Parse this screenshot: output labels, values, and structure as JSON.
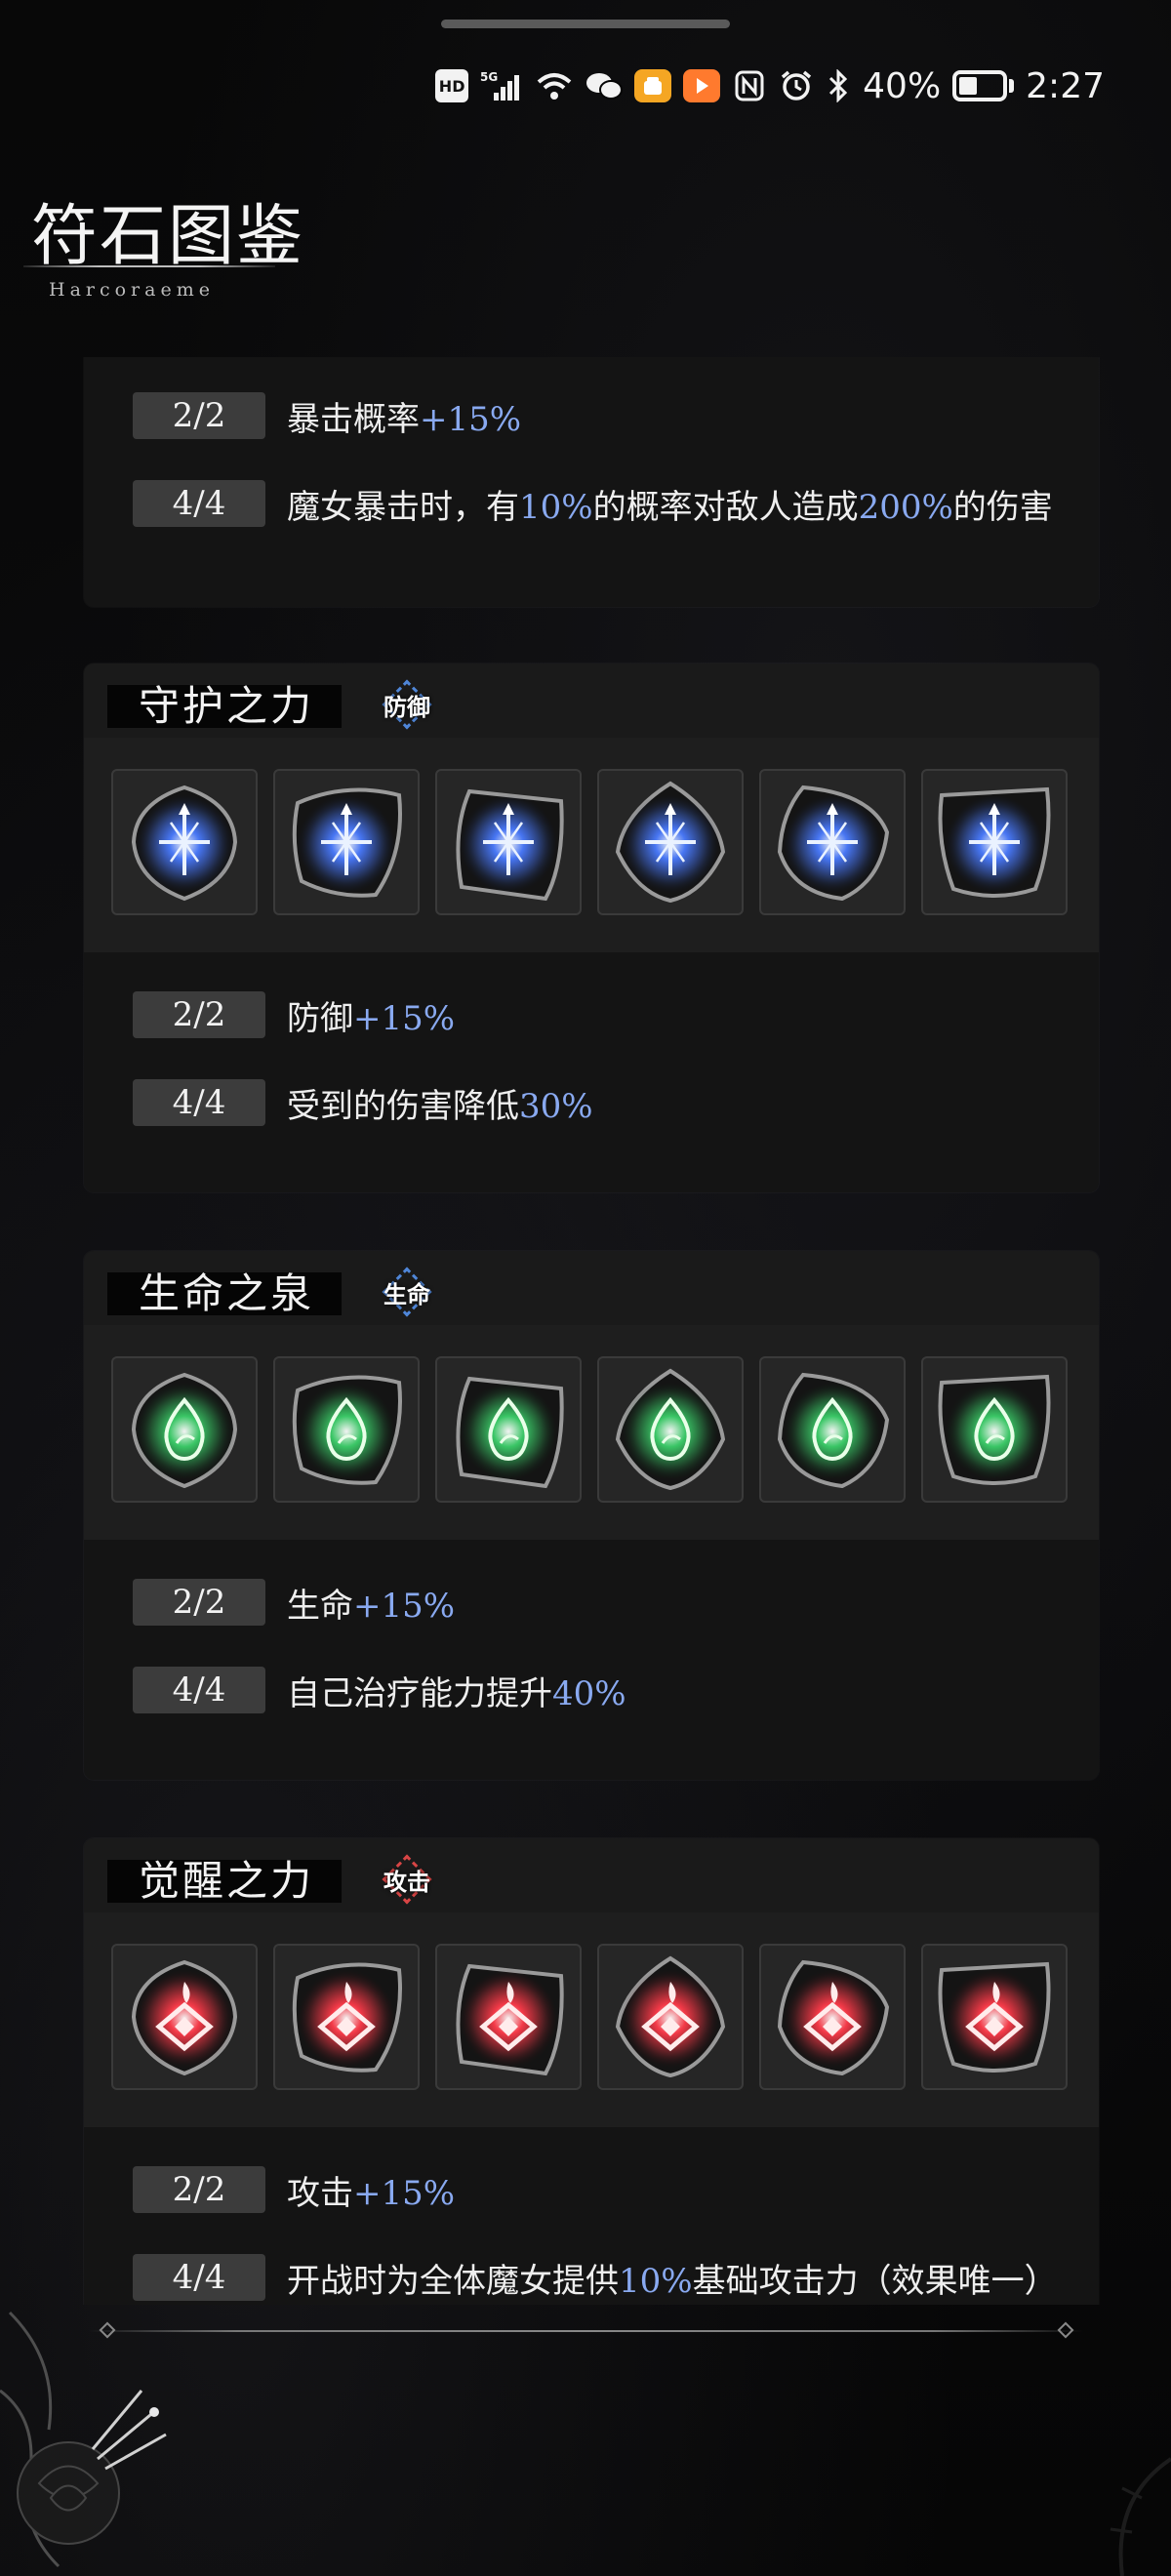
{
  "status_bar": {
    "hd": "HD",
    "network": "5G",
    "battery_text": "40%",
    "battery_level": 0.4,
    "time": "2:27",
    "icons": [
      "hd-icon",
      "signal-5g-icon",
      "wifi-icon",
      "wechat-icon",
      "app-notification-icon",
      "app-notification-icon",
      "nfc-icon",
      "alarm-icon",
      "bluetooth-icon",
      "battery-icon"
    ]
  },
  "header": {
    "title": "符石图鉴",
    "subtitle": "Harcoraeme"
  },
  "cards": [
    {
      "partial": true,
      "stats": [
        {
          "badge": "2/2",
          "parts": [
            {
              "t": "暴击概率"
            },
            {
              "t": "+15%",
              "hl": true
            }
          ]
        },
        {
          "badge": "4/4",
          "parts": [
            {
              "t": "魔女暴击时，有"
            },
            {
              "t": "10%",
              "hl": true
            },
            {
              "t": "的概率对敌人造成"
            },
            {
              "t": "200%",
              "hl": true
            },
            {
              "t": "的伤害"
            }
          ]
        }
      ]
    },
    {
      "title": "守护之力",
      "type": "防御",
      "type_kind": "def",
      "rune_icon": "blue-shield-cross-rune-icon",
      "rune_color": "#4a7bff",
      "rune_count": 6,
      "stats": [
        {
          "badge": "2/2",
          "parts": [
            {
              "t": "防御"
            },
            {
              "t": "+15%",
              "hl": true
            }
          ]
        },
        {
          "badge": "4/4",
          "parts": [
            {
              "t": "受到的伤害降低"
            },
            {
              "t": "30%",
              "hl": true
            }
          ]
        }
      ]
    },
    {
      "title": "生命之泉",
      "type": "生命",
      "type_kind": "life",
      "rune_icon": "green-leaf-drop-rune-icon",
      "rune_color": "#3ccf6a",
      "rune_count": 6,
      "stats": [
        {
          "badge": "2/2",
          "parts": [
            {
              "t": "生命"
            },
            {
              "t": "+15%",
              "hl": true
            }
          ]
        },
        {
          "badge": "4/4",
          "parts": [
            {
              "t": "自己治疗能力提升"
            },
            {
              "t": "40%",
              "hl": true
            }
          ]
        }
      ]
    },
    {
      "title": "觉醒之力",
      "type": "攻击",
      "type_kind": "atk",
      "rune_icon": "red-flame-diamond-rune-icon",
      "rune_color": "#ff3b4a",
      "rune_count": 6,
      "stats": [
        {
          "badge": "2/2",
          "parts": [
            {
              "t": "攻击"
            },
            {
              "t": "+15%",
              "hl": true
            }
          ]
        },
        {
          "badge": "4/4",
          "parts": [
            {
              "t": "开战时为全体魔女提供"
            },
            {
              "t": "10%",
              "hl": true
            },
            {
              "t": "基础攻击力（效果唯一）"
            }
          ]
        }
      ]
    }
  ],
  "colors": {
    "background": "#050505",
    "card": "#141414",
    "highlight": "#89a9f0",
    "defense": "#4f86d8",
    "attack": "#d84545"
  }
}
